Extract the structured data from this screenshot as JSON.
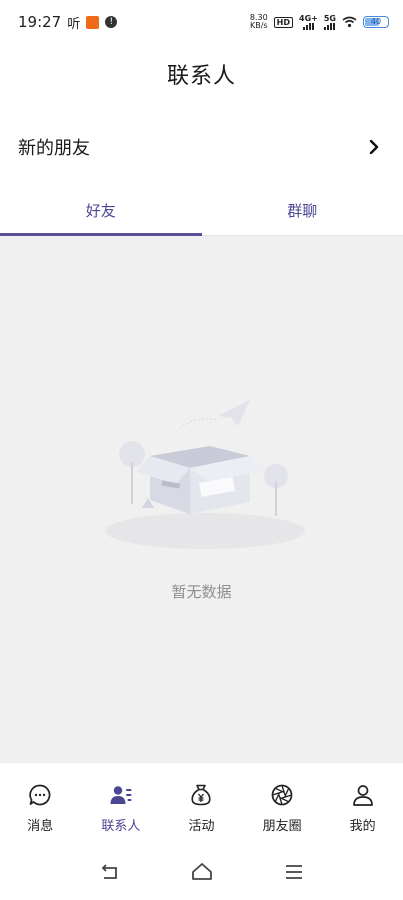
{
  "status_bar": {
    "time": "19:27",
    "ting": "听",
    "net_speed_value": "8.30",
    "net_speed_unit": "KB/s",
    "hd_label": "HD",
    "signal1_label": "4G+",
    "signal2_label": "5G",
    "battery_level": "40"
  },
  "header": {
    "title": "联系人"
  },
  "new_friends": {
    "label": "新的朋友"
  },
  "tabs": [
    {
      "label": "好友",
      "active": true
    },
    {
      "label": "群聊",
      "active": false
    }
  ],
  "empty_state": {
    "text": "暂无数据"
  },
  "bottom_nav": [
    {
      "label": "消息",
      "icon": "chat-bubble-icon",
      "active": false
    },
    {
      "label": "联系人",
      "icon": "contacts-icon",
      "active": true
    },
    {
      "label": "活动",
      "icon": "money-bag-icon",
      "active": false
    },
    {
      "label": "朋友圈",
      "icon": "aperture-icon",
      "active": false
    },
    {
      "label": "我的",
      "icon": "person-icon",
      "active": false
    }
  ],
  "colors": {
    "accent": "#5b4e9a",
    "content_bg": "#f0f0f0",
    "empty_text": "#8f8f8f"
  }
}
